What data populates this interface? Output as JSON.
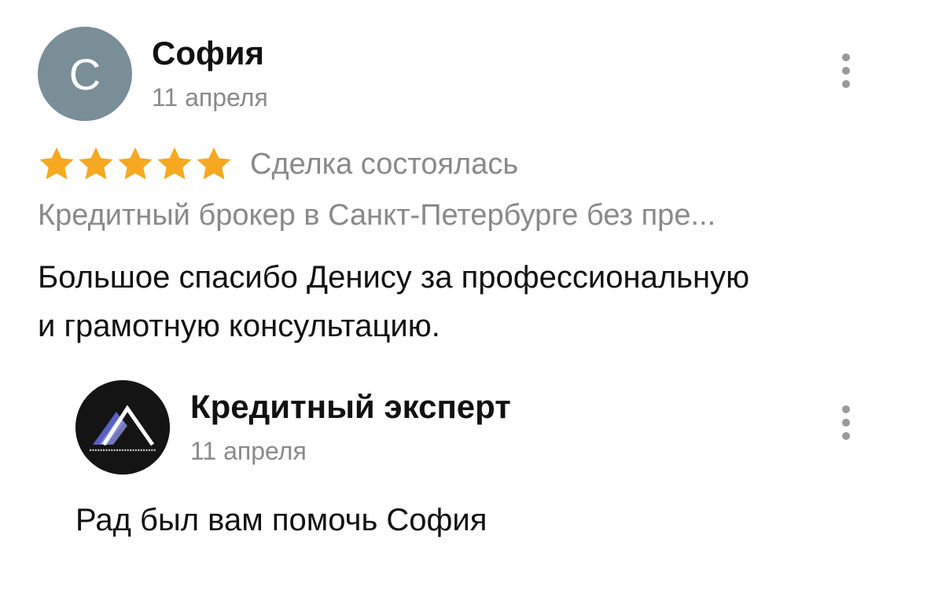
{
  "review": {
    "avatar_letter": "С",
    "author": "София",
    "date": "11 апреля",
    "rating": 5,
    "rating_max": 5,
    "deal_status": "Сделка состоялась",
    "organization": "Кредитный брокер в Санкт-Петербурге без пре...",
    "text_line1": "Большое спасибо Денису за профессиональную",
    "text_line2": "и грамотную консультацию."
  },
  "reply": {
    "author": "Кредитный эксперт",
    "date": "11 апреля",
    "text": "Рад был вам помочь София"
  },
  "colors": {
    "star": "#f6a821",
    "avatar_bg": "#7a8e98",
    "secondary_text": "#8a8a8a",
    "logo_accent": "#6a6fd0"
  },
  "icons": {
    "menu": "kebab-vertical-icon",
    "star": "star-icon"
  }
}
